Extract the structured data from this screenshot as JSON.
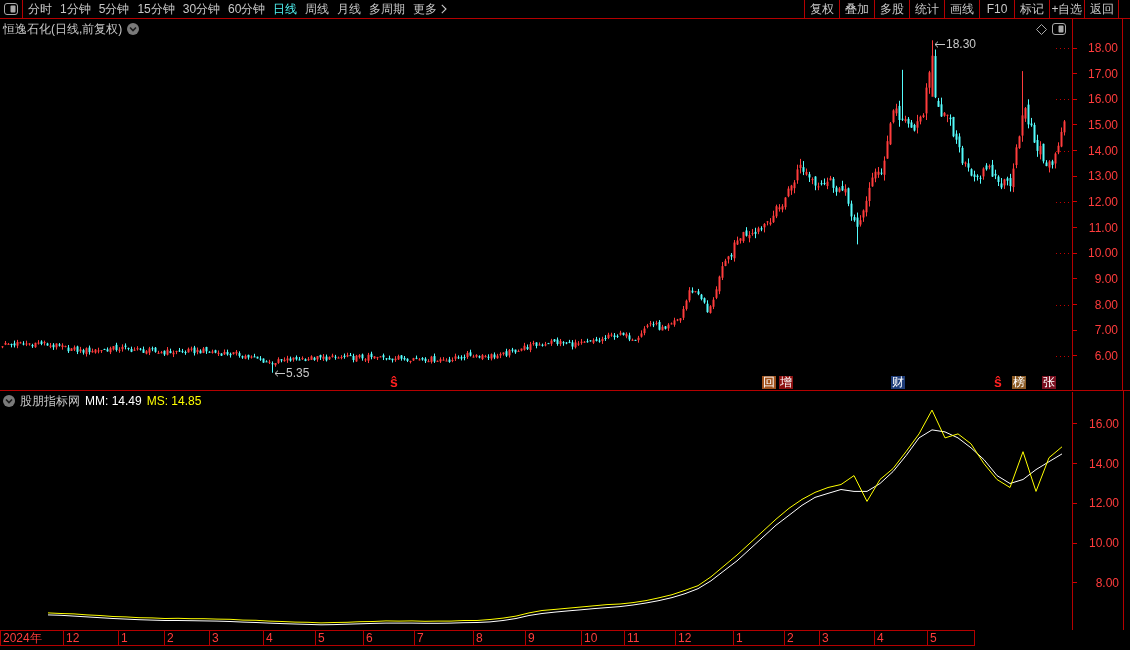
{
  "toolbar": {
    "periods": [
      {
        "label": "分时",
        "selected": false
      },
      {
        "label": "1分钟",
        "selected": false
      },
      {
        "label": "5分钟",
        "selected": false
      },
      {
        "label": "15分钟",
        "selected": false
      },
      {
        "label": "30分钟",
        "selected": false
      },
      {
        "label": "60分钟",
        "selected": false
      },
      {
        "label": "日线",
        "selected": true
      },
      {
        "label": "周线",
        "selected": false
      },
      {
        "label": "月线",
        "selected": false
      },
      {
        "label": "多周期",
        "selected": false
      }
    ],
    "more": {
      "label": "更多"
    },
    "buttons": [
      "复权",
      "叠加",
      "多股",
      "统计",
      "画线",
      "F10",
      "标记",
      "+自选",
      "返回"
    ]
  },
  "price_chart": {
    "title": "恒逸石化(日线,前复权)",
    "axis_labels": [
      "18.00",
      "17.00",
      "16.00",
      "15.00",
      "14.00",
      "13.00",
      "12.00",
      "11.00",
      "10.00",
      "9.00",
      "8.00",
      "7.00",
      "6.00"
    ],
    "high_label": "18.30",
    "low_label": "5.35",
    "event_markers": [
      {
        "kind": "glyph",
        "text": "ŝ",
        "color": "#ff2020"
      },
      {
        "kind": "tag",
        "text": "回",
        "color": "#a0521c"
      },
      {
        "kind": "tag",
        "text": "增",
        "color": "#8c1010"
      },
      {
        "kind": "tag",
        "text": "财",
        "color": "#1e3c78"
      },
      {
        "kind": "glyph",
        "text": "ŝ",
        "color": "#ff2020"
      },
      {
        "kind": "tag",
        "text": "榜",
        "color": "#8a5a24"
      },
      {
        "kind": "tag",
        "text": "张",
        "color": "#7a1020"
      }
    ]
  },
  "indicator": {
    "name": "股朋指标网",
    "readings": [
      ": 14.49",
      ": 14.85"
    ],
    "chart_data": {
      "type": "line",
      "categories": [
        null,
        null,
        null,
        null,
        null,
        null,
        null,
        null,
        null,
        null,
        null,
        null,
        null,
        null,
        null,
        null,
        null,
        null,
        null,
        null,
        null,
        null,
        null,
        null,
        null,
        null,
        null,
        null,
        null,
        null,
        null,
        null,
        null,
        null,
        null,
        null,
        null,
        null,
        null,
        null,
        null,
        null,
        null,
        null,
        null,
        null,
        null,
        null,
        null,
        null,
        null,
        null,
        null,
        null,
        null,
        null,
        null,
        null,
        null,
        null,
        null,
        null,
        null,
        null,
        null,
        null,
        null,
        null,
        null,
        null,
        null,
        null,
        null,
        null,
        null,
        null,
        null,
        null,
        null
      ],
      "ylim": [
        5.62,
        17.61
      ],
      "yticks": [
        {
          "value": 16,
          "label": "16.00"
        },
        {
          "value": 14,
          "label": "14.00"
        },
        {
          "value": 12,
          "label": "12.00"
        },
        {
          "value": 10,
          "label": "10.00"
        },
        {
          "value": 8,
          "label": "8.00"
        }
      ],
      "series": [
        {
          "name": "MM",
          "color": "#ffffff",
          "values": [
            6.38,
            6.36,
            6.32,
            6.28,
            6.24,
            6.2,
            6.17,
            6.14,
            6.12,
            6.1,
            6.1,
            6.09,
            6.08,
            6.07,
            6.05,
            6.02,
            6.0,
            5.97,
            5.94,
            5.92,
            5.9,
            5.88,
            5.89,
            5.91,
            5.93,
            5.95,
            5.97,
            5.97,
            5.97,
            5.96,
            5.96,
            5.97,
            5.99,
            6.0,
            6.03,
            6.1,
            6.2,
            6.35,
            6.45,
            6.52,
            6.58,
            6.64,
            6.7,
            6.75,
            6.8,
            6.88,
            6.98,
            7.1,
            7.25,
            7.45,
            7.7,
            8.1,
            8.6,
            9.1,
            9.7,
            10.3,
            10.9,
            11.4,
            11.9,
            12.3,
            12.5,
            12.7,
            12.6,
            12.6,
            13.0,
            13.6,
            14.4,
            15.3,
            15.7,
            15.6,
            15.3,
            14.8,
            14.2,
            13.4,
            13.0,
            13.2,
            13.7,
            14.1,
            14.49
          ]
        },
        {
          "name": "MS",
          "color": "#ffff00",
          "values": [
            6.48,
            6.45,
            6.43,
            6.38,
            6.35,
            6.3,
            6.28,
            6.24,
            6.23,
            6.2,
            6.21,
            6.19,
            6.19,
            6.17,
            6.16,
            6.12,
            6.11,
            6.07,
            6.05,
            6.02,
            6.01,
            5.98,
            6.0,
            6.01,
            6.04,
            6.05,
            6.08,
            6.07,
            6.08,
            6.06,
            6.07,
            6.07,
            6.1,
            6.1,
            6.15,
            6.22,
            6.32,
            6.48,
            6.6,
            6.66,
            6.72,
            6.78,
            6.84,
            6.9,
            6.93,
            7.0,
            7.1,
            7.24,
            7.4,
            7.62,
            7.85,
            8.3,
            8.85,
            9.4,
            10.0,
            10.6,
            11.2,
            11.75,
            12.2,
            12.55,
            12.8,
            12.95,
            13.4,
            12.1,
            13.2,
            13.75,
            14.6,
            15.5,
            16.7,
            15.3,
            15.5,
            15.0,
            14.0,
            13.2,
            12.8,
            14.6,
            12.6,
            14.3,
            14.85
          ]
        }
      ]
    }
  },
  "date_axis": [
    "2024年",
    "12",
    "1",
    "2",
    "3",
    "4",
    "5",
    "6",
    "7",
    "8",
    "9",
    "10",
    "11",
    "12",
    "1",
    "2",
    "3",
    "4",
    "5"
  ]
}
